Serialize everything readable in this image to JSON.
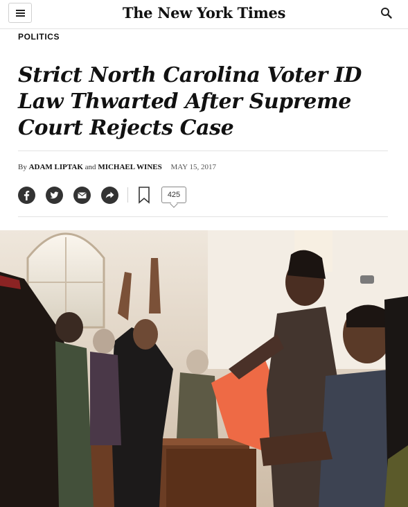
{
  "masthead": {
    "logo_text": "The New York Times"
  },
  "section": "POLITICS",
  "headline": "Strict North Carolina Voter ID Law Thwarted After Supreme Court Rejects Case",
  "byline": {
    "prefix": "By",
    "author1": "ADAM LIPTAK",
    "joiner": "and",
    "author2": "MICHAEL WINES",
    "date": "MAY 15, 2017"
  },
  "share": {
    "comment_count": "425"
  },
  "colors": {
    "icon": "#333333",
    "rule": "#e2e2e2",
    "text": "#121212"
  }
}
